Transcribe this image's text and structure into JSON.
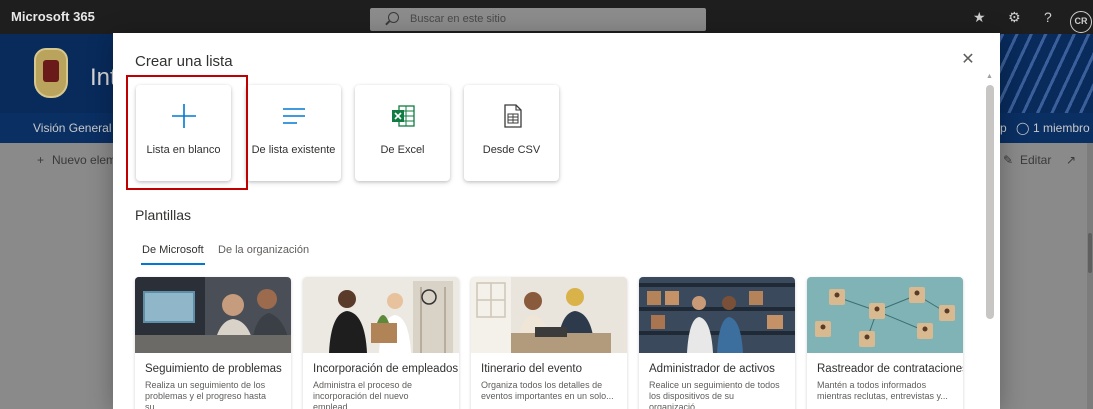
{
  "suite": {
    "brand": "Microsoft 365",
    "search_placeholder": "Buscar en este sitio",
    "avatar_initials": "CR"
  },
  "site": {
    "title": "Intr"
  },
  "nav": {
    "home": "Visión General",
    "members": "1 miembro"
  },
  "command": {
    "new_item": "Nuevo eleme",
    "edit": "Editar"
  },
  "modal": {
    "title": "Crear una lista",
    "create_options": [
      {
        "label": "Lista en blanco",
        "icon": "plus-icon"
      },
      {
        "label": "De lista existente",
        "icon": "list-lines-icon"
      },
      {
        "label": "De Excel",
        "icon": "excel-icon"
      },
      {
        "label": "Desde CSV",
        "icon": "csv-file-icon"
      }
    ],
    "templates_title": "Plantillas",
    "tabs": [
      {
        "label": "De Microsoft",
        "active": true
      },
      {
        "label": "De la organización",
        "active": false
      }
    ],
    "templates": [
      {
        "title": "Seguimiento de problemas",
        "desc": "Realiza un seguimiento de los problemas y el progreso hasta su..."
      },
      {
        "title": "Incorporación de empleados",
        "desc": "Administra el proceso de incorporación del nuevo emplead..."
      },
      {
        "title": "Itinerario del evento",
        "desc": "Organiza todos los detalles de eventos importantes en un solo..."
      },
      {
        "title": "Administrador de activos",
        "desc": "Realice un seguimiento de todos los dispositivos de su organizació..."
      },
      {
        "title": "Rastreador de contrataciones",
        "desc": "Mantén a todos informados mientras reclutas, entrevistas y..."
      }
    ]
  },
  "colors": {
    "accent": "#0078d4",
    "highlight": "#c00000",
    "excel": "#107c41"
  }
}
